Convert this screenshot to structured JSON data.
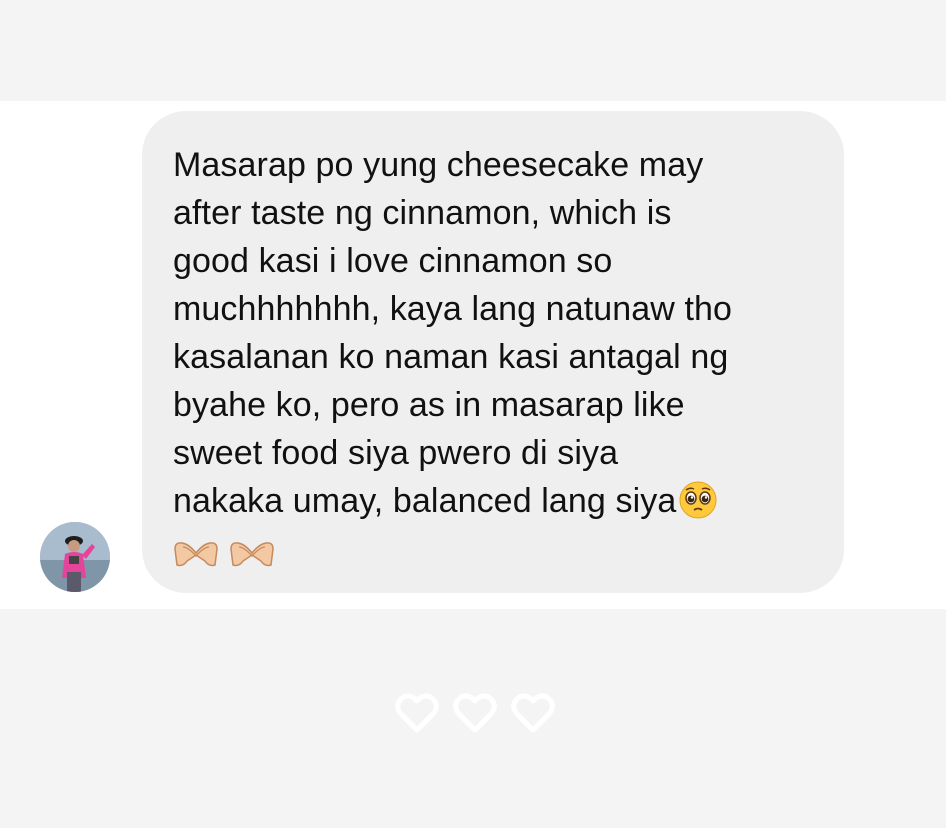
{
  "message": {
    "text_lines": [
      "Masarap po yung cheesecake may",
      "after taste ng cinnamon, which is",
      "good kasi i love cinnamon so",
      "muchhhhhhh, kaya lang natunaw tho",
      "kasalanan ko naman kasi antagal ng",
      "byahe ko, pero as in masarap like",
      "sweet food siya pwero di siya",
      "nakaka umay, balanced lang siya"
    ],
    "inline_emoji": "pleading-face-icon",
    "trailing_emojis": [
      "heart-hands-icon",
      "heart-hands-icon"
    ]
  },
  "sender": {
    "avatar_icon": "profile-photo"
  },
  "reactions": {
    "icons": [
      "heart-outline-icon",
      "heart-outline-icon",
      "heart-outline-icon"
    ]
  },
  "colors": {
    "page_background": "#f4f4f4",
    "message_band": "#ffffff",
    "bubble": "#efefef",
    "text": "#111111",
    "heart_outline": "#ffffff"
  }
}
